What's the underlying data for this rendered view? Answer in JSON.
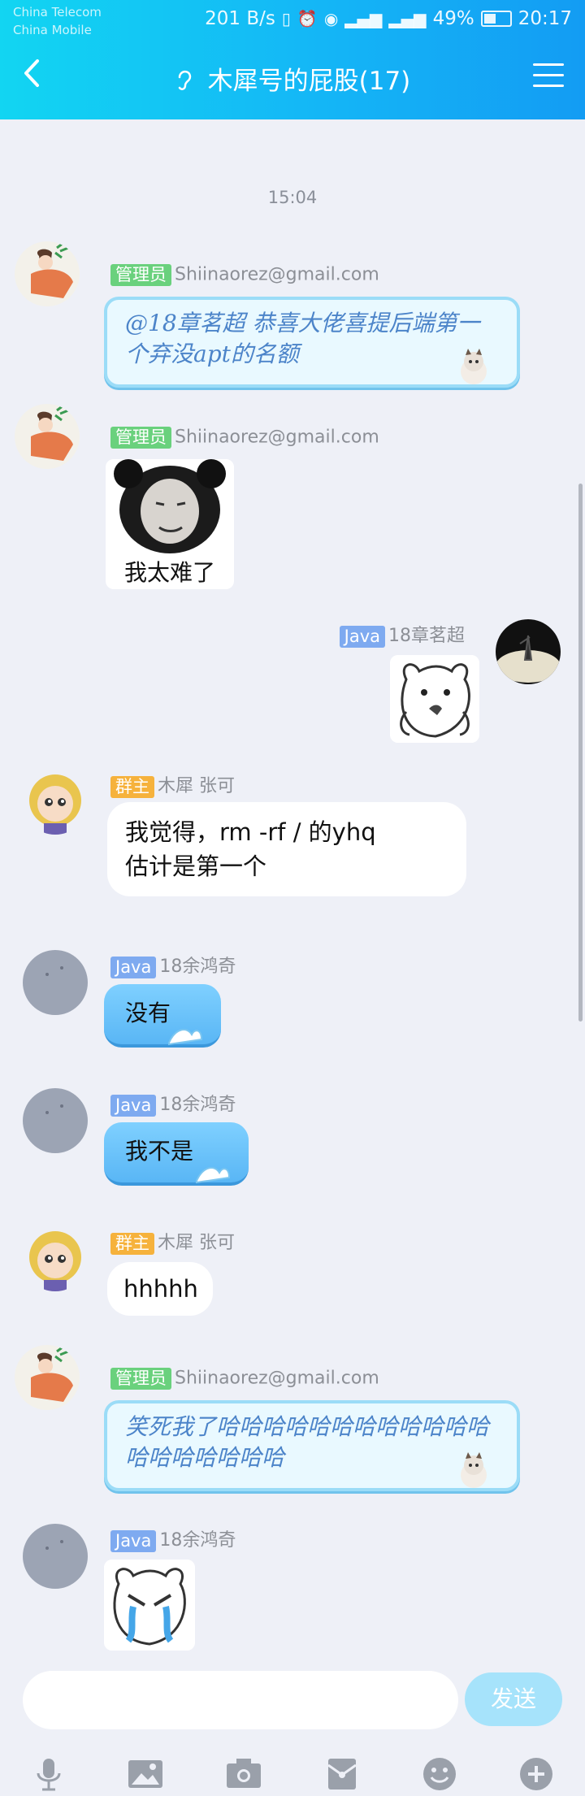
{
  "status_bar": {
    "carrier1": "China Telecom",
    "carrier2": "China Mobile",
    "speed": "201 B/s",
    "battery": "49%",
    "time": "20:17"
  },
  "header": {
    "title": "木犀号的屁股(17)"
  },
  "chat": {
    "timestamp": "15:04",
    "messages": [
      {
        "badge": "管理员",
        "name": "Shiinaorez@gmail.com",
        "text": "@18章茗超 恭喜大佬喜提后端第一个弃没apt的名额"
      },
      {
        "badge": "管理员",
        "name": "Shiinaorez@gmail.com",
        "sticker_caption": "我太难了"
      },
      {
        "badge": "Java",
        "name": "18章茗超"
      },
      {
        "badge": "群主",
        "name": "木犀 张可",
        "text1": "我觉得，rm -rf / 的yhq",
        "text2": "估计是第一个"
      },
      {
        "badge": "Java",
        "name": "18余鸿奇",
        "text": "没有"
      },
      {
        "badge": "Java",
        "name": "18余鸿奇",
        "text": "我不是"
      },
      {
        "badge": "群主",
        "name": "木犀 张可",
        "text": "hhhhh"
      },
      {
        "badge": "管理员",
        "name": "Shiinaorez@gmail.com",
        "text": "笑死我了哈哈哈哈哈哈哈哈哈哈哈哈哈哈哈哈哈哈哈"
      },
      {
        "badge": "Java",
        "name": "18余鸿奇"
      }
    ]
  },
  "composer": {
    "send_label": "发送"
  },
  "colors": {
    "header_start": "#12d5f2",
    "header_end": "#139cf3",
    "background": "#eef0f7"
  }
}
